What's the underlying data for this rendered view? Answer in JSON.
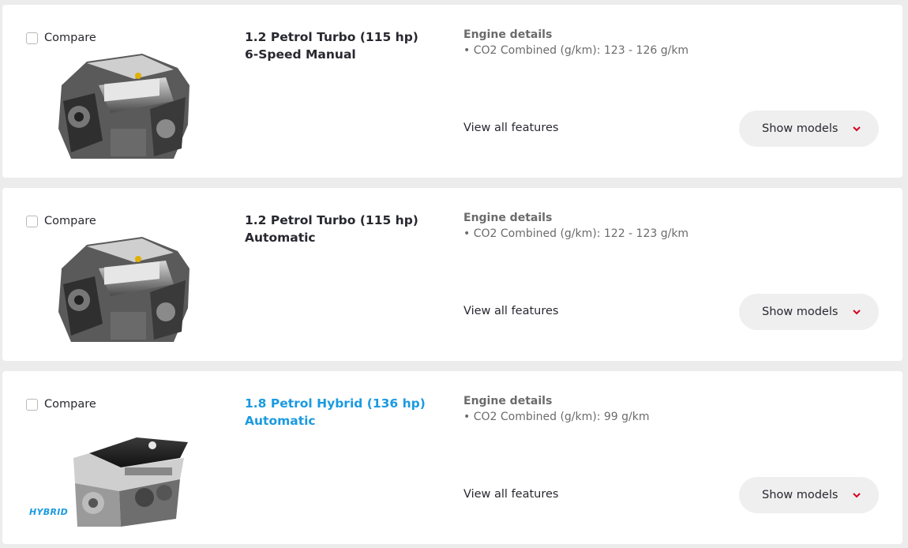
{
  "colors": {
    "background": "#ececec",
    "card": "#ffffff",
    "hybrid_accent": "#1b9ae0",
    "chevron": "#d6001c",
    "button_bg": "#efefef"
  },
  "engines": [
    {
      "compare_label": "Compare",
      "title_line1": "1.2 Petrol Turbo (115 hp)",
      "title_line2": "6-Speed Manual",
      "details_title": "Engine details",
      "co2": "• CO2 Combined (g/km): 123 - 126 g/km",
      "view_all": "View all features",
      "show_models": "Show models",
      "icon": "chevron-down-icon"
    },
    {
      "compare_label": "Compare",
      "title_line1": "1.2 Petrol Turbo (115 hp)",
      "title_line2": "Automatic",
      "details_title": "Engine details",
      "co2": "• CO2 Combined (g/km): 122 - 123 g/km",
      "view_all": "View all features",
      "show_models": "Show models",
      "icon": "chevron-down-icon"
    },
    {
      "compare_label": "Compare",
      "title_line1": "1.8 Petrol Hybrid (136 hp)",
      "title_line2": "Automatic",
      "details_title": "Engine details",
      "co2": "• CO2 Combined (g/km): 99 g/km",
      "view_all": "View all features",
      "show_models": "Show models",
      "badge": "HYBRID",
      "icon": "chevron-down-icon"
    }
  ]
}
